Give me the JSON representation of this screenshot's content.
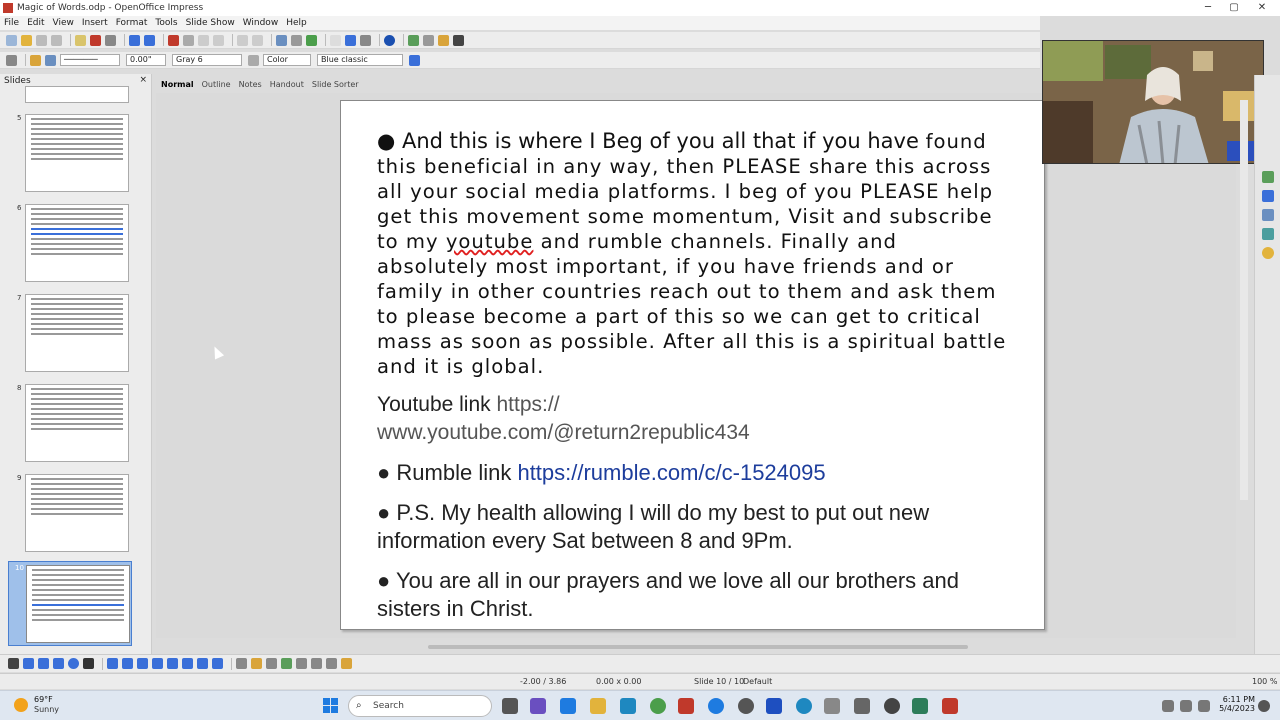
{
  "window": {
    "title": "Magic of Words.odp - OpenOffice Impress",
    "minimize": "─",
    "maximize": "▢",
    "close": "✕"
  },
  "menu": [
    "File",
    "Edit",
    "View",
    "Insert",
    "Format",
    "Tools",
    "Slide Show",
    "Window",
    "Help"
  ],
  "toolbar2": {
    "line_width": "0.00\"",
    "line_color": "Gray 6",
    "area_style": "Color",
    "area_color": "Blue classic"
  },
  "slides_panel": {
    "title": "Slides",
    "close": "×",
    "slide_numbers": [
      "5",
      "6",
      "7",
      "8",
      "9",
      "10"
    ]
  },
  "view_tabs": [
    "Normal",
    "Outline",
    "Notes",
    "Handout",
    "Slide Sorter"
  ],
  "slide": {
    "p1_lead": "●  And this is where I Beg of you all that if you have ",
    "p1_rest_a": "found this beneficial in any way, then PLEASE share this across all your social media platforms. I beg of you PLEASE help get this movement some momentum, Visit and subscribe to my ",
    "p1_youtube": "youtube",
    "p1_rest_b": " and rumble channels. Finally and absolutely most important, if you have friends and or family in other countries reach out to them and ask them to please become a part of this so we can get to critical mass as soon as possible. After all this is a spiritual battle and it is global.",
    "yt_label": "Youtube link ",
    "yt_url_a": "https://",
    "yt_url_b": "www.youtube.com/@return2republic434",
    "rumble_label": "●  Rumble link ",
    "rumble_url": "https://rumble.com/c/c-1524095",
    "ps": "●  P.S. My health allowing I will do my best to put out new information every Sat between 8 and 9Pm.",
    "prayers": "●  You are all in our prayers and we love all our  brothers and sisters in Christ."
  },
  "status": {
    "position": "-2.00 / 3.86",
    "size": "0.00 x 0.00",
    "slide": "Slide 10 / 10",
    "layout": "Default",
    "zoom": "100 %"
  },
  "taskbar": {
    "temp": "69°F",
    "condition": "Sunny",
    "search_placeholder": "Search",
    "time": "6:11 PM",
    "date": "5/4/2023"
  }
}
